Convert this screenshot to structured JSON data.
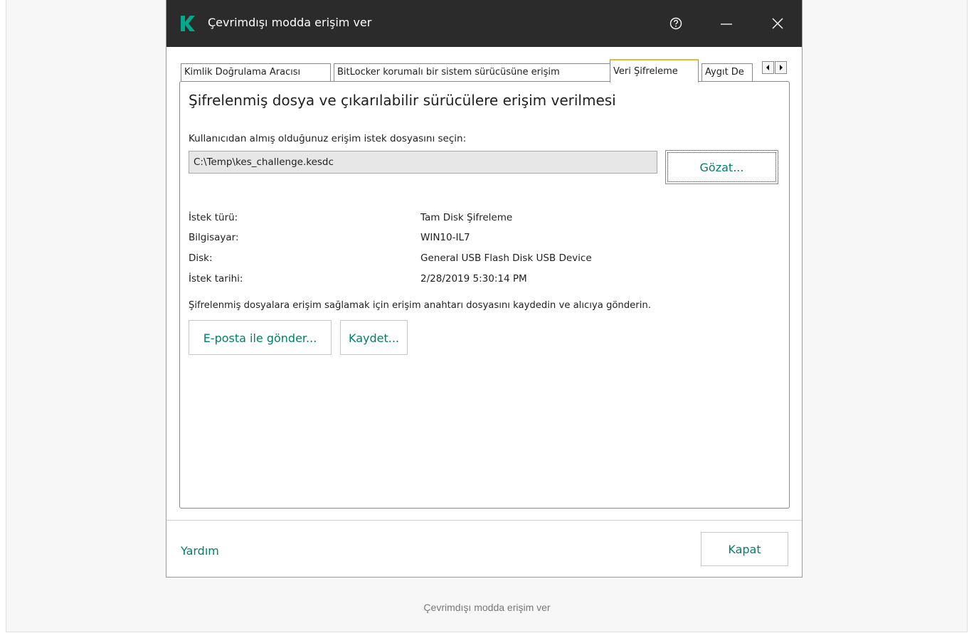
{
  "window": {
    "title": "Çevrimdışı modda erişim ver",
    "help_icon": "help-circle-icon",
    "minimize_icon": "minimize-icon",
    "close_icon": "close-icon"
  },
  "tabs": [
    {
      "label": "Kimlik Doğrulama Aracısı",
      "active": false
    },
    {
      "label": "BitLocker korumalı bir sistem sürücüsüne erişim",
      "active": false
    },
    {
      "label": "Veri Şifreleme",
      "active": true
    },
    {
      "label": "Aygıt De",
      "active": false
    }
  ],
  "main": {
    "heading": "Şifrelenmiş dosya ve çıkarılabilir sürücülere erişim verilmesi",
    "file_prompt": "Kullanıcıdan almış olduğunuz erişim istek dosyasını seçin:",
    "file_value": "C:\\Temp\\kes_challenge.kesdc",
    "browse_label": "Gözat...",
    "details": [
      {
        "label": "İstek türü:",
        "value": "Tam Disk Şifreleme"
      },
      {
        "label": "Bilgisayar:",
        "value": "WIN10-IL7"
      },
      {
        "label": "Disk:",
        "value": "General USB Flash Disk USB Device"
      },
      {
        "label": "İstek tarihi:",
        "value": "2/28/2019 5:30:14 PM"
      }
    ],
    "instruction": "Şifrelenmiş dosyalara erişim sağlamak için erişim anahtarı dosyasını kaydedin ve alıcıya gönderin.",
    "email_label": "E-posta ile gönder...",
    "save_label": "Kaydet..."
  },
  "footer": {
    "help_label": "Yardım",
    "close_label": "Kapat"
  },
  "caption": "Çevrimdışı modda erişim ver",
  "colors": {
    "accent": "#00806a",
    "titlebar": "#2b2b2b",
    "logo": "#00a88e",
    "active_tab_border": "#e8b830"
  }
}
